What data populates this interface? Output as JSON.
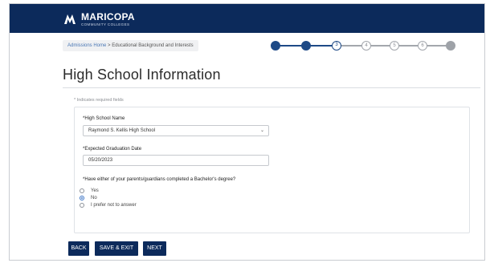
{
  "header": {
    "logo_name": "MARICOPA",
    "logo_sub": "COMMUNITY COLLEGES"
  },
  "breadcrumb": {
    "home": "Admissions Home",
    "separator": " > ",
    "current": "Educational Background and Interests"
  },
  "stepper": {
    "steps": [
      "",
      "",
      "3",
      "4",
      "5",
      "6",
      ""
    ],
    "current_step": 3
  },
  "page": {
    "title": "High School Information",
    "required_note": "* Indicates required fields"
  },
  "form": {
    "high_school": {
      "label": "*High School Name",
      "value": "Raymond S. Kellis High School"
    },
    "graduation_date": {
      "label": "*Expected Graduation Date",
      "value": "05/20/2023"
    },
    "parents_degree": {
      "question": "*Have either of your parents/guardians completed a Bachelor's degree?",
      "options": [
        "Yes",
        "No",
        "I prefer not to answer"
      ],
      "selected": "No"
    }
  },
  "buttons": {
    "back": "BACK",
    "save_exit": "SAVE & EXIT",
    "next": "NEXT"
  },
  "colors": {
    "navy": "#0c2a5b",
    "step_done": "#1e4a86",
    "radio_selected": "#3a73c4"
  }
}
